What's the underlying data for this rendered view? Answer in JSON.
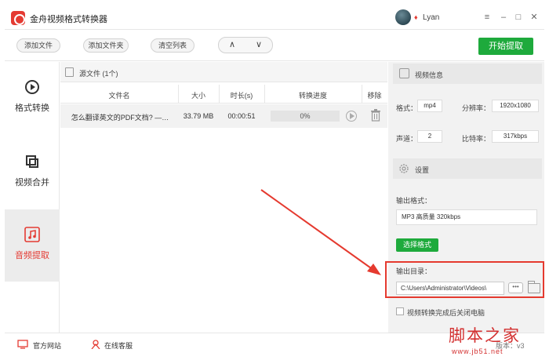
{
  "app": {
    "title": "金舟视频格式转换器",
    "user_name": "Lyan",
    "vip_symbol": "♦",
    "window_controls": {
      "menu": "≡",
      "minimize": "–",
      "maximize": "□",
      "close": "✕"
    }
  },
  "toolbar": {
    "add_file": "添加文件",
    "add_folder": "添加文件夹",
    "clear_list": "清空列表",
    "move_up": "∧",
    "move_down": "∨",
    "start": "开始提取"
  },
  "sidebar": {
    "items": [
      {
        "label": "格式转换",
        "icon": "play-circle-icon",
        "active": false
      },
      {
        "label": "视频合并",
        "icon": "merge-icon",
        "active": false
      },
      {
        "label": "音频提取",
        "icon": "music-note-icon",
        "active": true
      }
    ]
  },
  "source": {
    "title": "源文件 (1个)",
    "columns": [
      "文件名",
      "大小",
      "时长(s)",
      "转换进度",
      "移除"
    ],
    "rows": [
      {
        "name": "怎么翻译英文的PDF文档? —…",
        "size": "33.79 MB",
        "duration": "00:00:51",
        "progress": "0%"
      }
    ]
  },
  "video_info": {
    "title": "视频信息",
    "format_label": "格式：",
    "format_value": "mp4",
    "resolution_label": "分辨率：",
    "resolution_value": "1920x1080",
    "channel_label": "声道：",
    "channel_value": "2",
    "bitrate_label": "比特率：",
    "bitrate_value": "317kbps"
  },
  "settings": {
    "title": "设置",
    "output_format_label": "输出格式：",
    "output_format_value": "MP3 高质量 320kbps",
    "select_format": "选择格式",
    "output_dir_label": "输出目录：",
    "output_dir_value": "C:\\Users\\Administrator\\Videos\\",
    "more": "•••",
    "shutdown_label": "视频转换完成后关闭电脑"
  },
  "footer": {
    "website": "官方网站",
    "support": "在线客服",
    "version": "版本：v3"
  },
  "watermark": {
    "main": "脚本之家",
    "url": "www.jb51.net"
  },
  "colors": {
    "accent_green": "#1eaa3c",
    "brand_red": "#e43b33",
    "highlight_red": "#e53a2f"
  }
}
